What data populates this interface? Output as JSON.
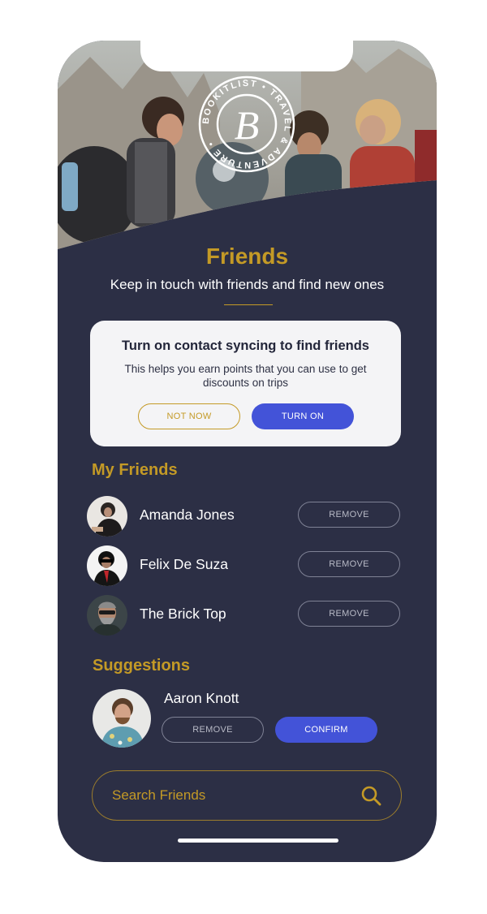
{
  "brand": {
    "logo_letter": "B",
    "logo_ring_text": "BOOKITLIST • TRAVEL & ADVENTURE •"
  },
  "header": {
    "title": "Friends",
    "subtitle": "Keep in touch with friends and find new ones"
  },
  "sync_card": {
    "title": "Turn on contact syncing to find friends",
    "body": "This helps you earn points that you can use to get discounts on trips",
    "not_now_label": "NOT NOW",
    "turn_on_label": "TURN ON"
  },
  "my_friends": {
    "heading": "My Friends",
    "items": [
      {
        "name": "Amanda Jones",
        "action": "REMOVE"
      },
      {
        "name": "Felix De Suza",
        "action": "REMOVE"
      },
      {
        "name": "The Brick Top",
        "action": "REMOVE"
      }
    ]
  },
  "suggestions": {
    "heading": "Suggestions",
    "items": [
      {
        "name": "Aaron Knott",
        "remove_label": "REMOVE",
        "confirm_label": "CONFIRM"
      }
    ]
  },
  "search": {
    "placeholder": "Search Friends"
  },
  "colors": {
    "background": "#2c2f45",
    "accent_gold": "#c49a26",
    "primary_blue": "#4353d8",
    "card": "#f4f4f6"
  },
  "icons": {
    "search": "magnifier-icon"
  }
}
